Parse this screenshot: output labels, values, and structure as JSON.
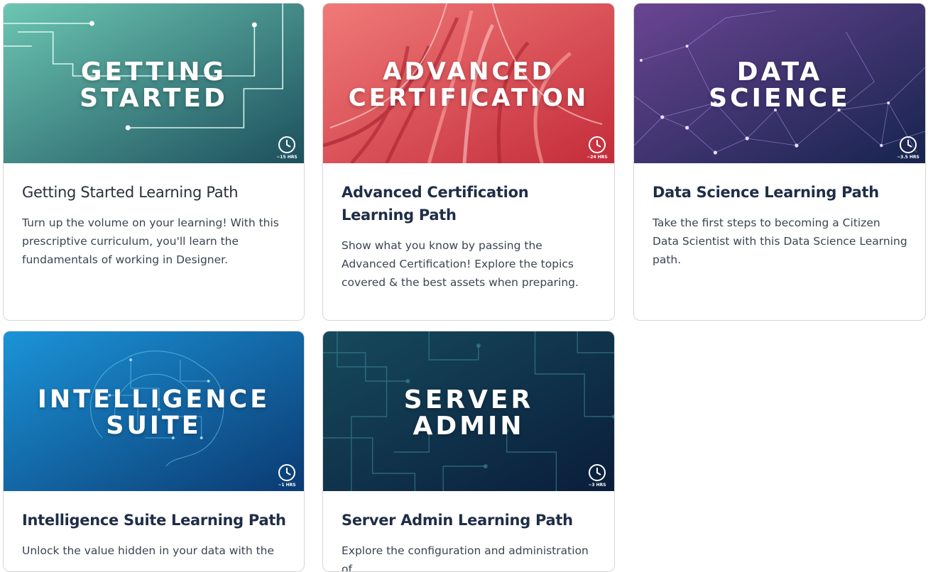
{
  "cards": [
    {
      "banner_line1": "GETTING",
      "banner_line2": "STARTED",
      "hours": "~15 HRS",
      "title": "Getting Started Learning Path",
      "description": "Turn up the volume on your learning! With this prescriptive curriculum, you'll learn the fundamentals of working in Designer.",
      "colors": [
        "#5fb8a6",
        "#1f5862"
      ]
    },
    {
      "banner_line1": "ADVANCED",
      "banner_line2": "CERTIFICATION",
      "hours": "~24 HRS",
      "title": "Advanced Certification Learning Path",
      "description": "Show what you know by passing the Advanced Certification! Explore the topics covered & the best assets when preparing.",
      "colors": [
        "#ef6d6e",
        "#c8333d"
      ]
    },
    {
      "banner_line1": "DATA",
      "banner_line2": "SCIENCE",
      "hours": "~3.5 HRS",
      "title": "Data Science Learning Path",
      "description": "Take the first steps to becoming a Citizen Data Scientist with this Data Science Learning path.",
      "colors": [
        "#5b3b82",
        "#1d2a55"
      ]
    },
    {
      "banner_line1": "INTELLIGENCE",
      "banner_line2": "SUITE",
      "hours": "~1 HRS",
      "title": "Intelligence Suite Learning Path",
      "description": "Unlock the value hidden in your data with the",
      "colors": [
        "#1a8ad0",
        "#0c3e78"
      ]
    },
    {
      "banner_line1": "SERVER",
      "banner_line2": "ADMIN",
      "hours": "~3 HRS",
      "title": "Server Admin Learning Path",
      "description": "Explore the configuration and administration of",
      "colors": [
        "#134456",
        "#0b2140"
      ]
    }
  ]
}
